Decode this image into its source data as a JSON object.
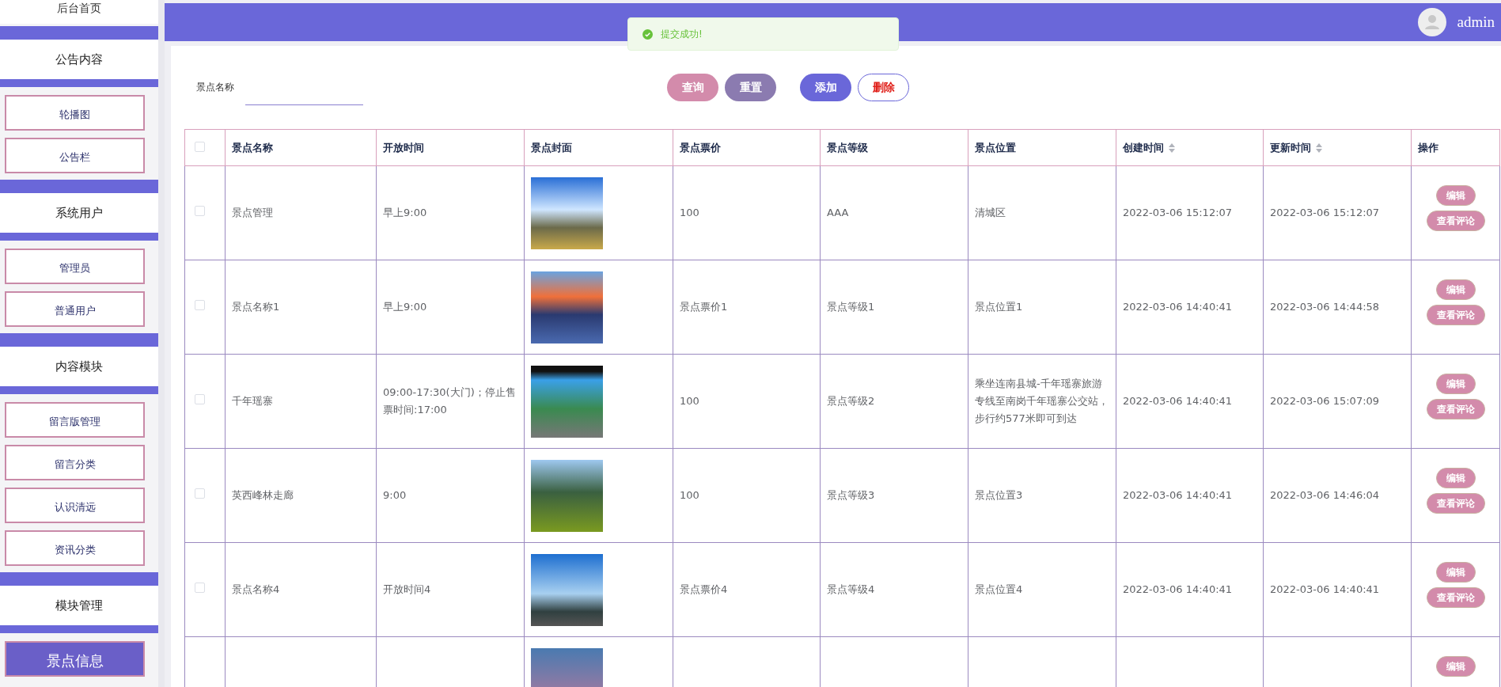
{
  "sidebar": {
    "home": "后台首页",
    "groups": [
      {
        "title": "公告内容",
        "children": [
          {
            "label": "轮播图",
            "selected": false
          },
          {
            "label": "公告栏",
            "selected": false
          }
        ]
      },
      {
        "title": "系统用户",
        "children": [
          {
            "label": "管理员",
            "selected": false
          },
          {
            "label": "普通用户",
            "selected": false
          }
        ]
      },
      {
        "title": "内容模块",
        "children": [
          {
            "label": "留言版管理",
            "selected": false
          },
          {
            "label": "留言分类",
            "selected": false
          },
          {
            "label": "认识清远",
            "selected": false
          },
          {
            "label": "资讯分类",
            "selected": false
          }
        ]
      },
      {
        "title": "模块管理",
        "children": [
          {
            "label": "景点信息",
            "selected": true
          }
        ]
      }
    ]
  },
  "header": {
    "user": "admin"
  },
  "toast": {
    "message": "提交成功!"
  },
  "search": {
    "label": "景点名称",
    "buttons": [
      {
        "label": "查询",
        "kind": "query"
      },
      {
        "label": "重置",
        "kind": "reset"
      },
      {
        "label": "添加",
        "kind": "add"
      },
      {
        "label": "删除",
        "kind": "delete"
      }
    ]
  },
  "table": {
    "select_all": {
      "checked": false
    },
    "columns": [
      {
        "label": "景点名称",
        "kind": "text"
      },
      {
        "label": "开放时间",
        "kind": "text"
      },
      {
        "label": "景点封面",
        "kind": "image"
      },
      {
        "label": "景点票价",
        "kind": "text"
      },
      {
        "label": "景点等级",
        "kind": "text"
      },
      {
        "label": "景点位置",
        "kind": "text"
      },
      {
        "label": "创建时间",
        "kind": "text",
        "sortable": true
      },
      {
        "label": "更新时间",
        "kind": "text",
        "sortable": true
      },
      {
        "label": "操作",
        "kind": "actions"
      }
    ],
    "rows": [
      {
        "checked": false,
        "cells": [
          "景点管理",
          "早上9:00",
          "",
          "100",
          "AAA",
          "清城区",
          "2022-03-06 15:12:07",
          "2022-03-06 15:12:07"
        ],
        "actions": [
          "编辑",
          "查看评论"
        ]
      },
      {
        "checked": false,
        "cells": [
          "景点名称1",
          "早上9:00",
          "",
          "景点票价1",
          "景点等级1",
          "景点位置1",
          "2022-03-06 14:40:41",
          "2022-03-06 14:44:58"
        ],
        "actions": [
          "编辑",
          "查看评论"
        ]
      },
      {
        "checked": false,
        "cells": [
          "千年瑶寨",
          "09:00-17:30(大门)；停止售票时间:17:00",
          "",
          "100",
          "景点等级2",
          "乘坐连南县城-千年瑶寨旅游专线至南岗千年瑶寨公交站，步行约577米即可到达",
          "2022-03-06 14:40:41",
          "2022-03-06 15:07:09"
        ],
        "actions": [
          "编辑",
          "查看评论"
        ]
      },
      {
        "checked": false,
        "cells": [
          "英西峰林走廊",
          "9:00",
          "",
          "100",
          "景点等级3",
          "景点位置3",
          "2022-03-06 14:40:41",
          "2022-03-06 14:46:04"
        ],
        "actions": [
          "编辑",
          "查看评论"
        ]
      },
      {
        "checked": false,
        "cells": [
          "景点名称4",
          "开放时间4",
          "",
          "景点票价4",
          "景点等级4",
          "景点位置4",
          "2022-03-06 14:40:41",
          "2022-03-06 14:40:41"
        ],
        "actions": [
          "编辑",
          "查看评论"
        ]
      },
      {
        "cells": [],
        "actions": [
          "编辑"
        ]
      }
    ]
  }
}
